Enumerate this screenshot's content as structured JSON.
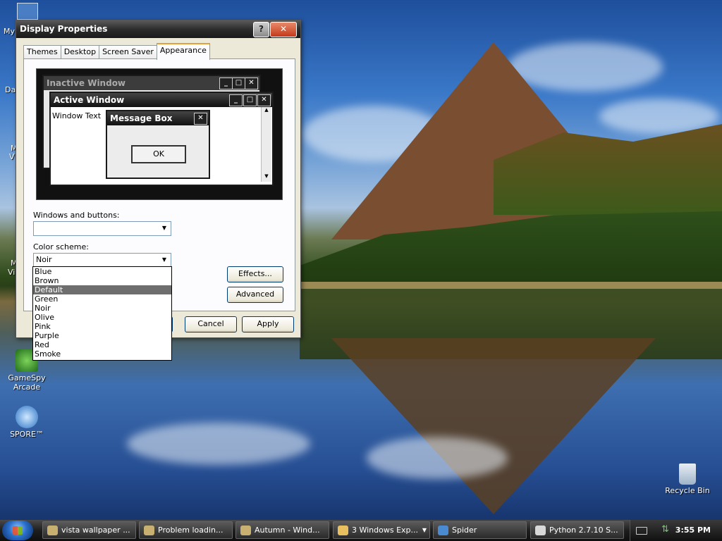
{
  "desktop": {
    "icons": [
      {
        "label": "GameSpy Arcade",
        "name": "gamespy-arcade-icon"
      },
      {
        "label": "SPORE™",
        "name": "spore-icon"
      },
      {
        "label": "Recycle Bin",
        "name": "recycle-bin-icon"
      }
    ],
    "cut_labels": [
      "My",
      "Da",
      "M",
      "V",
      "M",
      "Vi"
    ]
  },
  "dialog": {
    "title": "Display Properties",
    "help_glyph": "?",
    "close_glyph": "✕",
    "tabs": [
      "Themes",
      "Desktop",
      "Screen Saver",
      "Appearance"
    ],
    "active_tab": "Appearance",
    "preview": {
      "inactive_title": "Inactive Window",
      "active_title": "Active Window",
      "window_text": "Window Text",
      "message_box_title": "Message Box",
      "ok_label": "OK"
    },
    "windows_buttons_label": "Windows and buttons:",
    "windows_buttons_value": "",
    "color_scheme_label": "Color scheme:",
    "color_scheme_value": "Noir",
    "color_scheme_options": [
      "Blue",
      "Brown",
      "Default",
      "Green",
      "Noir",
      "Olive",
      "Pink",
      "Purple",
      "Red",
      "Smoke"
    ],
    "highlighted_option": "Default",
    "effects_label": "Effects...",
    "advanced_label": "Advanced",
    "cancel_label": "Cancel",
    "apply_label": "Apply"
  },
  "taskbar": {
    "items": [
      {
        "label": "vista wallpaper ...",
        "icon": "browser-icon"
      },
      {
        "label": "Problem loadin...",
        "icon": "browser-icon"
      },
      {
        "label": "Autumn - Wind...",
        "icon": "browser-icon"
      },
      {
        "label": "3 Windows Exp...",
        "icon": "folder-icon"
      },
      {
        "label": "Spider",
        "icon": "spider-solitaire-icon"
      },
      {
        "label": "Python 2.7.10 S...",
        "icon": "python-icon"
      }
    ],
    "clock": "3:55 PM"
  },
  "colors": {
    "accent_tab": "#e6a03a",
    "selection": "#6e6e6e",
    "titlebar": "#2d2d2d"
  }
}
